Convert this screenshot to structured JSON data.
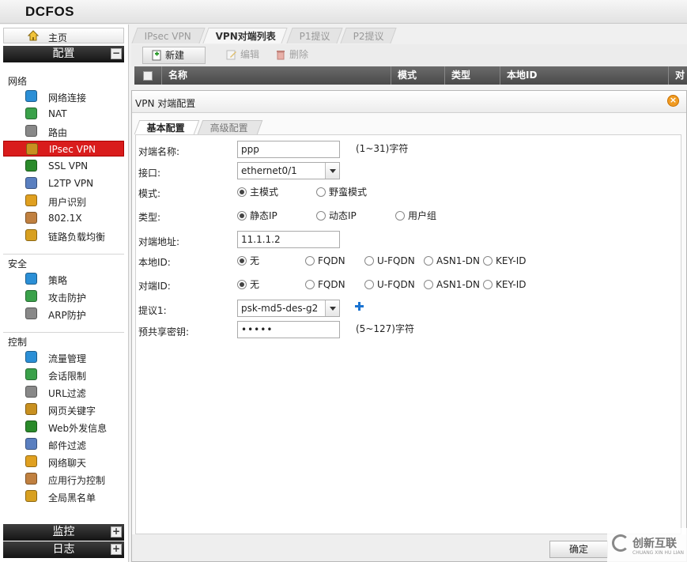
{
  "app": {
    "brand": "DCFOS"
  },
  "sidebar": {
    "home": "主页",
    "config_section": "配置",
    "config_toggle": "−",
    "groups": {
      "network": "网络",
      "security": "安全",
      "control": "控制"
    },
    "network_items": [
      "网络连接",
      "NAT",
      "路由",
      "IPsec VPN",
      "SSL VPN",
      "L2TP VPN",
      "用户识别",
      "802.1X",
      "链路负载均衡"
    ],
    "security_items": [
      "策略",
      "攻击防护",
      "ARP防护"
    ],
    "control_items": [
      "流量管理",
      "会话限制",
      "URL过滤",
      "网页关键字",
      "Web外发信息",
      "邮件过滤",
      "网络聊天",
      "应用行为控制",
      "全局黑名单"
    ],
    "monitor_section": "监控",
    "log_section": "日志",
    "expand_symbol": "+",
    "active_item": "IPsec VPN",
    "icons": {
      "network": [
        "globe-icon",
        "nat-icon",
        "router-icon",
        "ipsec-icon",
        "ssl-vpn-icon",
        "l2tp-icon",
        "user-id-icon",
        "dot1x-icon",
        "load-balance-icon"
      ],
      "security": [
        "policy-icon",
        "shield-icon",
        "arp-icon"
      ],
      "control": [
        "traffic-icon",
        "session-limit-icon",
        "url-filter-icon",
        "keyword-icon",
        "web-out-icon",
        "mail-filter-icon",
        "chat-icon",
        "app-control-icon",
        "blacklist-icon"
      ]
    }
  },
  "tabs": [
    "IPsec VPN",
    "VPN对端列表",
    "P1提议",
    "P2提议"
  ],
  "active_tab": "VPN对端列表",
  "toolbar": {
    "new": "新建",
    "edit": "编辑",
    "delete": "删除"
  },
  "grid": {
    "columns": [
      "名称",
      "模式",
      "类型",
      "本地ID",
      "对"
    ]
  },
  "dialog": {
    "title": "VPN 对端配置",
    "tabs": [
      "基本配置",
      "高级配置"
    ],
    "confirm": "确定",
    "fields": {
      "peer_name": {
        "label": "对端名称:",
        "value": "ppp",
        "hint": "(1~31)字符"
      },
      "interface": {
        "label": "接口:",
        "value": "ethernet0/1"
      },
      "mode": {
        "label": "模式:",
        "options": [
          "主模式",
          "野蛮模式"
        ],
        "selected": "主模式"
      },
      "type": {
        "label": "类型:",
        "options": [
          "静态IP",
          "动态IP",
          "用户组"
        ],
        "selected": "静态IP"
      },
      "peer_address": {
        "label": "对端地址:",
        "value": "11.1.1.2"
      },
      "local_id": {
        "label": "本地ID:",
        "options": [
          "无",
          "FQDN",
          "U-FQDN",
          "ASN1-DN",
          "KEY-ID"
        ],
        "selected": "无"
      },
      "peer_id": {
        "label": "对端ID:",
        "options": [
          "无",
          "FQDN",
          "U-FQDN",
          "ASN1-DN",
          "KEY-ID"
        ],
        "selected": "无"
      },
      "proposal1": {
        "label": "提议1:",
        "value": "psk-md5-des-g2"
      },
      "psk": {
        "label": "预共享密钥:",
        "value": "•••••",
        "hint": "(5~127)字符"
      }
    }
  },
  "watermark": {
    "text": "创新互联",
    "sub": "CHUANG XIN HU LIAN"
  },
  "colors": {
    "active_red": "#d91c1c",
    "header_dark": "#4a4a4a",
    "accent_blue": "#1a73d1"
  }
}
